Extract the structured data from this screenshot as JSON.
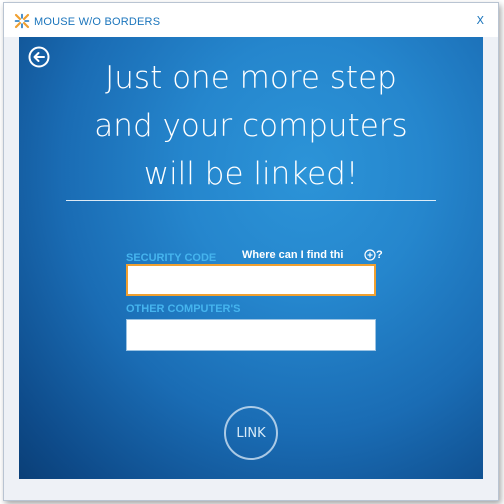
{
  "window": {
    "title": "MOUSE W/O BORDERS",
    "close_label": "X"
  },
  "colors": {
    "accent": "#1b75bc",
    "label": "#45b4ee",
    "focus_border": "#f0a030",
    "background": "#2586cd"
  },
  "icons": {
    "app": "mouse-without-borders-icon",
    "back": "back-arrow-circle-icon",
    "help": "help-circle-icon"
  },
  "main": {
    "headline_line1": "Just one more step",
    "headline_line2": "and your computers",
    "headline_line3": "will be linked!",
    "security_code_label": "SECURITY CODE",
    "help_link": "Where can I find thi",
    "help_suffix": "?",
    "security_code_value": "",
    "other_computer_label": "OTHER COMPUTER'S",
    "other_computer_value": "",
    "link_button": "LINK"
  }
}
